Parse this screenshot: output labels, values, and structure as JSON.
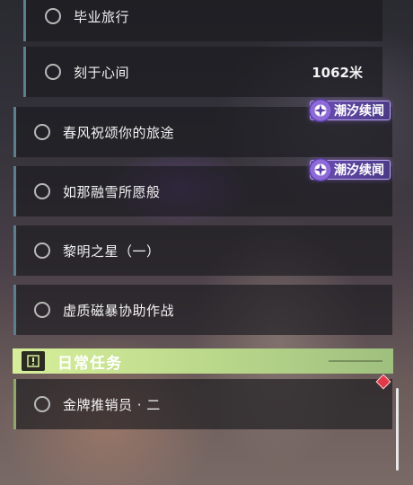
{
  "quests": [
    {
      "label": "毕业旅行",
      "distance": ""
    },
    {
      "label": "刻于心间",
      "distance": "1062米"
    },
    {
      "label": "春风祝颂你的旅途",
      "distance": ""
    },
    {
      "label": "如那融雪所愿般",
      "distance": ""
    },
    {
      "label": "黎明之星（一）",
      "distance": ""
    },
    {
      "label": "虚质磁暴协助作战",
      "distance": ""
    }
  ],
  "tags": [
    {
      "label": "潮汐续闻"
    },
    {
      "label": "潮汐续闻"
    }
  ],
  "daily_section": {
    "title": "日常任务",
    "icon": "exclamation-icon",
    "quests": [
      {
        "label": "金牌推销员 · 二"
      }
    ]
  },
  "colors": {
    "tag_purple": "#6d4fb5",
    "daily_green": "#d6ef9a",
    "quest_bar": "#5c7f8f",
    "alert_red": "#e03a4a"
  }
}
